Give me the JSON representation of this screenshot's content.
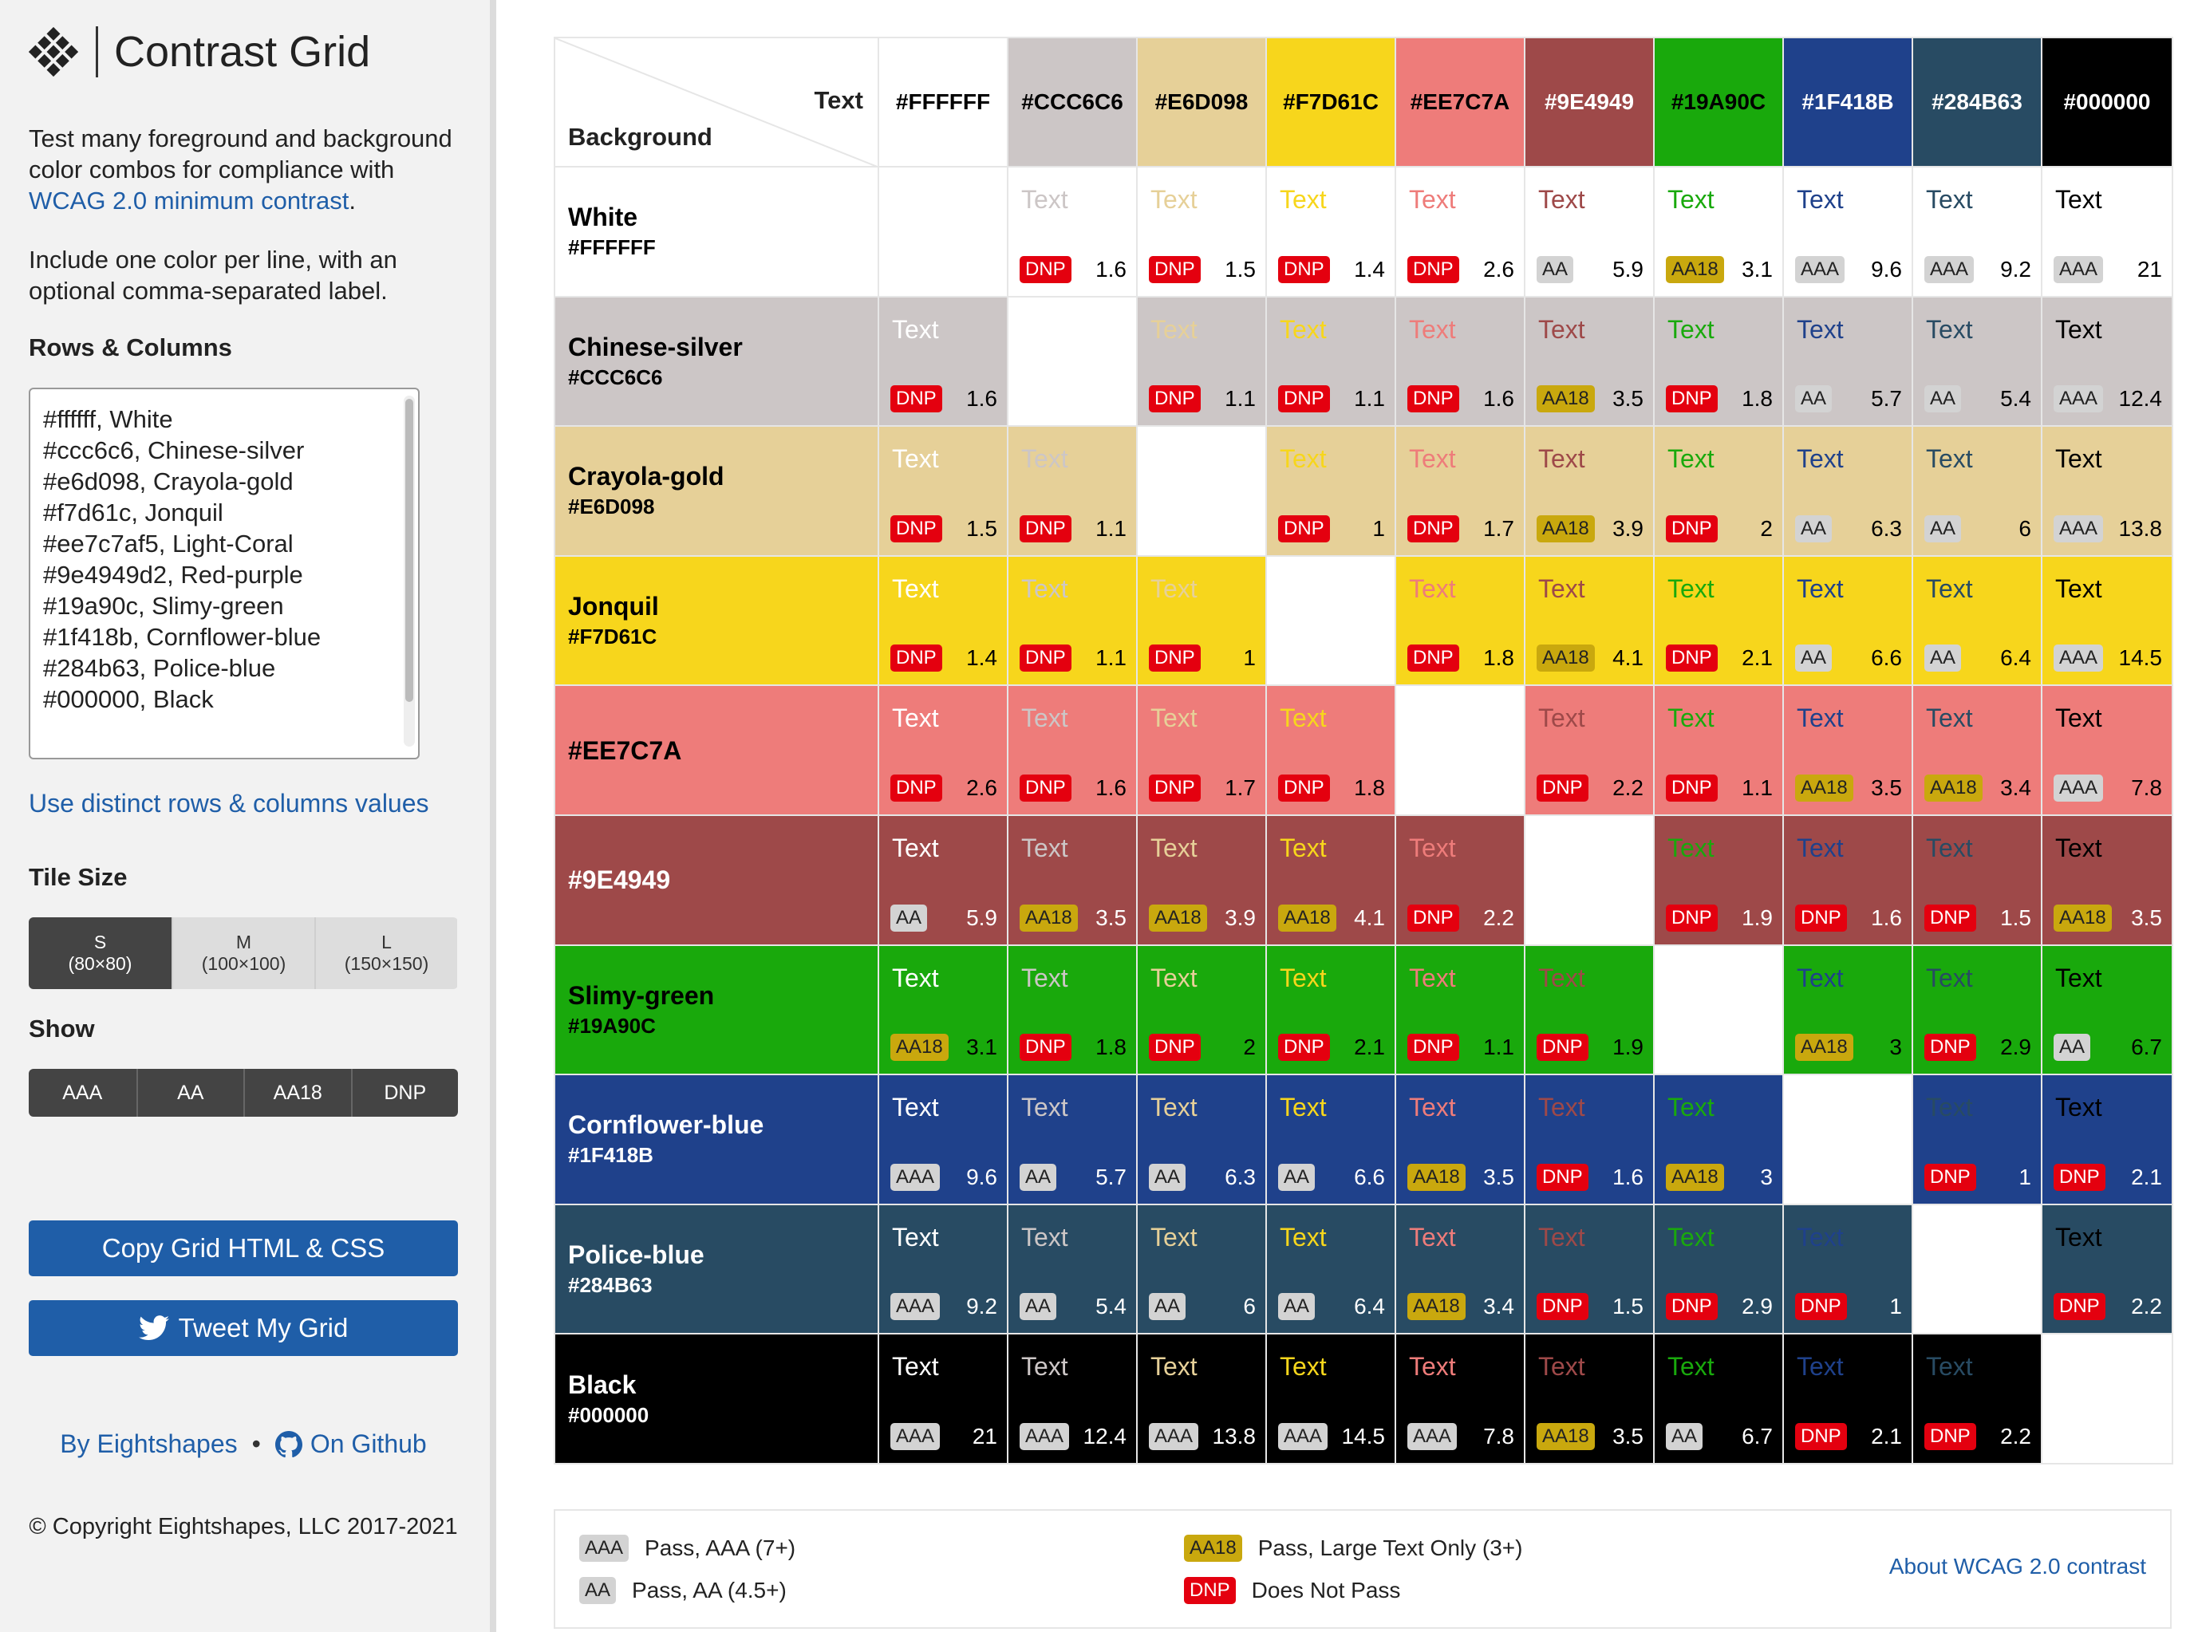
{
  "app": {
    "title": "Contrast Grid",
    "description_prefix": "Test many foreground and background color combos for compliance with",
    "description_link": "WCAG 2.0 minimum contrast",
    "description_suffix": ".",
    "instructions": "Include one color per line, with an optional comma-separated label."
  },
  "rows_columns": {
    "heading": "Rows & Columns",
    "input_value": "#ffffff, White\n#ccc6c6, Chinese-silver\n#e6d098, Crayola-gold\n#f7d61c, Jonquil\n#ee7c7af5, Light-Coral\n#9e4949d2, Red-purple\n#19a90c, Slimy-green\n#1f418b, Cornflower-blue\n#284b63, Police-blue\n#000000, Black",
    "distinct_link": "Use distinct rows & columns values"
  },
  "tile_size": {
    "heading": "Tile Size",
    "options": [
      {
        "label": "S",
        "detail": "(80×80)",
        "active": true
      },
      {
        "label": "M",
        "detail": "(100×100)",
        "active": false
      },
      {
        "label": "L",
        "detail": "(150×150)",
        "active": false
      }
    ]
  },
  "show": {
    "heading": "Show",
    "options": [
      "AAA",
      "AA",
      "AA18",
      "DNP"
    ]
  },
  "buttons": {
    "copy": "Copy Grid HTML & CSS",
    "tweet": "Tweet My Grid"
  },
  "footer": {
    "by": "By Eightshapes",
    "github": "On Github",
    "copyright": "© Copyright Eightshapes, LLC 2017-2021"
  },
  "grid": {
    "corner_text": "Text",
    "corner_background": "Background",
    "sample_text": "Text",
    "columns": [
      {
        "hex": "#FFFFFF",
        "color": "#FFFFFF",
        "text_color": "#000000"
      },
      {
        "hex": "#CCC6C6",
        "color": "#CCC6C6",
        "text_color": "#000000"
      },
      {
        "hex": "#E6D098",
        "color": "#E6D098",
        "text_color": "#000000"
      },
      {
        "hex": "#F7D61C",
        "color": "#F7D61C",
        "text_color": "#000000"
      },
      {
        "hex": "#EE7C7A",
        "color": "#EE7C7A",
        "text_color": "#000000"
      },
      {
        "hex": "#9E4949",
        "color": "#9E4949",
        "text_color": "#FFFFFF"
      },
      {
        "hex": "#19A90C",
        "color": "#19A90C",
        "text_color": "#000000"
      },
      {
        "hex": "#1F418B",
        "color": "#1F418B",
        "text_color": "#FFFFFF"
      },
      {
        "hex": "#284B63",
        "color": "#284B63",
        "text_color": "#FFFFFF"
      },
      {
        "hex": "#000000",
        "color": "#000000",
        "text_color": "#FFFFFF"
      }
    ],
    "rows": [
      {
        "name": "White",
        "hex": "#FFFFFF",
        "color": "#FFFFFF",
        "label_color": "#000000",
        "cells": [
          null,
          [
            "DNP",
            "1.6"
          ],
          [
            "DNP",
            "1.5"
          ],
          [
            "DNP",
            "1.4"
          ],
          [
            "DNP",
            "2.6"
          ],
          [
            "AA",
            "5.9"
          ],
          [
            "AA18",
            "3.1"
          ],
          [
            "AAA",
            "9.6"
          ],
          [
            "AAA",
            "9.2"
          ],
          [
            "AAA",
            "21"
          ]
        ]
      },
      {
        "name": "Chinese-silver",
        "hex": "#CCC6C6",
        "color": "#CCC6C6",
        "label_color": "#000000",
        "cells": [
          [
            "DNP",
            "1.6"
          ],
          null,
          [
            "DNP",
            "1.1"
          ],
          [
            "DNP",
            "1.1"
          ],
          [
            "DNP",
            "1.6"
          ],
          [
            "AA18",
            "3.5"
          ],
          [
            "DNP",
            "1.8"
          ],
          [
            "AA",
            "5.7"
          ],
          [
            "AA",
            "5.4"
          ],
          [
            "AAA",
            "12.4"
          ]
        ]
      },
      {
        "name": "Crayola-gold",
        "hex": "#E6D098",
        "color": "#E6D098",
        "label_color": "#000000",
        "cells": [
          [
            "DNP",
            "1.5"
          ],
          [
            "DNP",
            "1.1"
          ],
          null,
          [
            "DNP",
            "1"
          ],
          [
            "DNP",
            "1.7"
          ],
          [
            "AA18",
            "3.9"
          ],
          [
            "DNP",
            "2"
          ],
          [
            "AA",
            "6.3"
          ],
          [
            "AA",
            "6"
          ],
          [
            "AAA",
            "13.8"
          ]
        ]
      },
      {
        "name": "Jonquil",
        "hex": "#F7D61C",
        "color": "#F7D61C",
        "label_color": "#000000",
        "cells": [
          [
            "DNP",
            "1.4"
          ],
          [
            "DNP",
            "1.1"
          ],
          [
            "DNP",
            "1"
          ],
          null,
          [
            "DNP",
            "1.8"
          ],
          [
            "AA18",
            "4.1"
          ],
          [
            "DNP",
            "2.1"
          ],
          [
            "AA",
            "6.6"
          ],
          [
            "AA",
            "6.4"
          ],
          [
            "AAA",
            "14.5"
          ]
        ]
      },
      {
        "name": "#EE7C7A",
        "hex": "",
        "color": "#EE7C7A",
        "label_color": "#000000",
        "cells": [
          [
            "DNP",
            "2.6"
          ],
          [
            "DNP",
            "1.6"
          ],
          [
            "DNP",
            "1.7"
          ],
          [
            "DNP",
            "1.8"
          ],
          null,
          [
            "DNP",
            "2.2"
          ],
          [
            "DNP",
            "1.1"
          ],
          [
            "AA18",
            "3.5"
          ],
          [
            "AA18",
            "3.4"
          ],
          [
            "AAA",
            "7.8"
          ]
        ]
      },
      {
        "name": "#9E4949",
        "hex": "",
        "color": "#9E4949",
        "label_color": "#FFFFFF",
        "cells": [
          [
            "AA",
            "5.9"
          ],
          [
            "AA18",
            "3.5"
          ],
          [
            "AA18",
            "3.9"
          ],
          [
            "AA18",
            "4.1"
          ],
          [
            "DNP",
            "2.2"
          ],
          null,
          [
            "DNP",
            "1.9"
          ],
          [
            "DNP",
            "1.6"
          ],
          [
            "DNP",
            "1.5"
          ],
          [
            "AA18",
            "3.5"
          ]
        ]
      },
      {
        "name": "Slimy-green",
        "hex": "#19A90C",
        "color": "#19A90C",
        "label_color": "#000000",
        "cells": [
          [
            "AA18",
            "3.1"
          ],
          [
            "DNP",
            "1.8"
          ],
          [
            "DNP",
            "2"
          ],
          [
            "DNP",
            "2.1"
          ],
          [
            "DNP",
            "1.1"
          ],
          [
            "DNP",
            "1.9"
          ],
          null,
          [
            "AA18",
            "3"
          ],
          [
            "DNP",
            "2.9"
          ],
          [
            "AA",
            "6.7"
          ]
        ]
      },
      {
        "name": "Cornflower-blue",
        "hex": "#1F418B",
        "color": "#1F418B",
        "label_color": "#FFFFFF",
        "cells": [
          [
            "AAA",
            "9.6"
          ],
          [
            "AA",
            "5.7"
          ],
          [
            "AA",
            "6.3"
          ],
          [
            "AA",
            "6.6"
          ],
          [
            "AA18",
            "3.5"
          ],
          [
            "DNP",
            "1.6"
          ],
          [
            "AA18",
            "3"
          ],
          null,
          [
            "DNP",
            "1"
          ],
          [
            "DNP",
            "2.1"
          ]
        ]
      },
      {
        "name": "Police-blue",
        "hex": "#284B63",
        "color": "#284B63",
        "label_color": "#FFFFFF",
        "cells": [
          [
            "AAA",
            "9.2"
          ],
          [
            "AA",
            "5.4"
          ],
          [
            "AA",
            "6"
          ],
          [
            "AA",
            "6.4"
          ],
          [
            "AA18",
            "3.4"
          ],
          [
            "DNP",
            "1.5"
          ],
          [
            "DNP",
            "2.9"
          ],
          [
            "DNP",
            "1"
          ],
          null,
          [
            "DNP",
            "2.2"
          ]
        ]
      },
      {
        "name": "Black",
        "hex": "#000000",
        "color": "#000000",
        "label_color": "#FFFFFF",
        "cells": [
          [
            "AAA",
            "21"
          ],
          [
            "AAA",
            "12.4"
          ],
          [
            "AAA",
            "13.8"
          ],
          [
            "AAA",
            "14.5"
          ],
          [
            "AAA",
            "7.8"
          ],
          [
            "AA18",
            "3.5"
          ],
          [
            "AA",
            "6.7"
          ],
          [
            "DNP",
            "2.1"
          ],
          [
            "DNP",
            "2.2"
          ],
          null
        ]
      }
    ]
  },
  "legend": {
    "items": [
      {
        "badge": "AAA",
        "text": "Pass, AAA (7+)"
      },
      {
        "badge": "AA",
        "text": "Pass, AA (4.5+)"
      },
      {
        "badge": "AA18",
        "text": "Pass, Large Text Only (3+)"
      },
      {
        "badge": "DNP",
        "text": "Does Not Pass"
      }
    ],
    "link": "About WCAG 2.0 contrast"
  },
  "colors": {
    "link": "#1f5ea8",
    "dnp": "#e4000f",
    "aa18": "#c9a80e",
    "aa": "#d3d3d3"
  }
}
